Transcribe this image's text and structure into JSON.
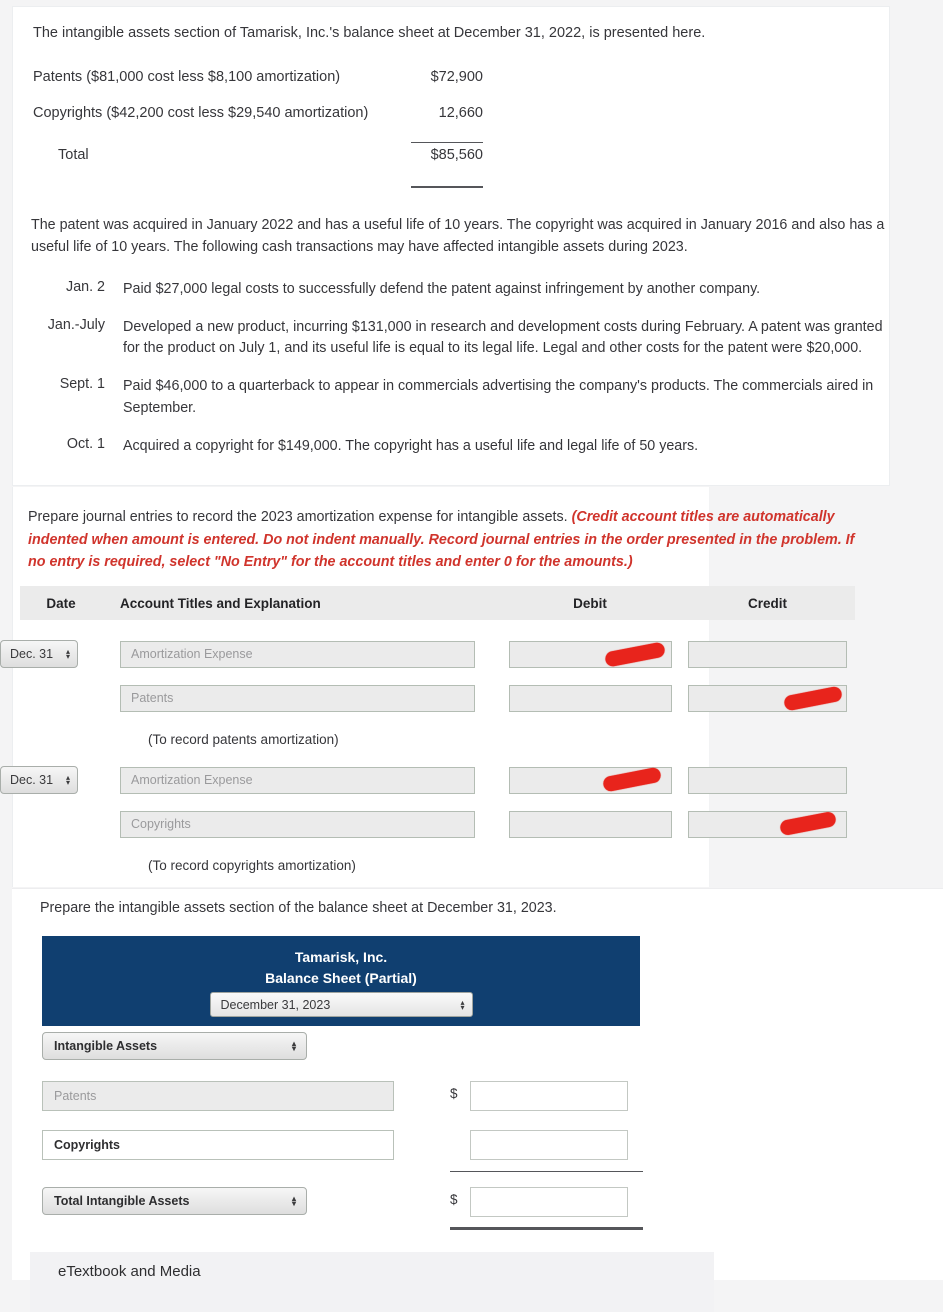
{
  "problem": {
    "intro": "The intangible assets section of Tamarisk, Inc.'s balance sheet at December 31, 2022, is presented here.",
    "summary": {
      "rows": [
        {
          "label": "Patents ($81,000 cost less $8,100 amortization)",
          "amount": "$72,900"
        },
        {
          "label": "Copyrights ($42,200 cost less $29,540 amortization)",
          "amount": "12,660"
        },
        {
          "label": "Total",
          "amount": "$85,560"
        }
      ]
    },
    "paragraph": "The patent was acquired in January 2022 and has a useful life of 10 years. The copyright was acquired in January 2016 and also has a useful life of 10 years. The following cash transactions may have affected intangible assets during 2023.",
    "transactions": [
      {
        "date": "Jan. 2",
        "text": "Paid $27,000 legal costs to successfully defend the patent against infringement by another company."
      },
      {
        "date": "Jan.-July",
        "text": "Developed a new product, incurring $131,000 in research and development costs during February. A patent was granted for the product on July 1, and its useful life is equal to its legal life. Legal and other costs for the patent were $20,000."
      },
      {
        "date": "Sept. 1",
        "text": "Paid $46,000 to a quarterback to appear in commercials advertising the company's products. The commercials aired in September."
      },
      {
        "date": "Oct. 1",
        "text": "Acquired a copyright for $149,000. The copyright has a useful life and legal life of 50 years."
      }
    ]
  },
  "journal": {
    "instruction_plain": "Prepare journal entries to record the 2023 amortization expense for intangible assets.",
    "instruction_italic": "(Credit account titles are automatically indented when amount is entered. Do not indent manually. Record journal entries in the order presented in the problem. If no entry is required, select \"No Entry\" for the account titles and enter 0 for the amounts.)",
    "headers": {
      "date": "Date",
      "account": "Account Titles and Explanation",
      "debit": "Debit",
      "credit": "Credit"
    },
    "entries": [
      {
        "date_value": "Dec. 31",
        "debit_line": {
          "account_placeholder": "Amortization Expense",
          "debit_value": "",
          "credit_value": ""
        },
        "credit_line": {
          "account_placeholder": "Patents",
          "debit_value": "",
          "credit_value": ""
        },
        "memo": "(To record patents amortization)"
      },
      {
        "date_value": "Dec. 31",
        "debit_line": {
          "account_placeholder": "Amortization Expense",
          "debit_value": "",
          "credit_value": ""
        },
        "credit_line": {
          "account_placeholder": "Copyrights",
          "debit_value": "",
          "credit_value": ""
        },
        "memo": "(To record copyrights amortization)"
      }
    ]
  },
  "balance_sheet": {
    "prompt": "Prepare the intangible assets section of the balance sheet at December 31, 2023.",
    "company": "Tamarisk, Inc.",
    "statement": "Balance Sheet (Partial)",
    "date_selected": "December 31, 2023",
    "section_header": "Intangible Assets",
    "rows": [
      {
        "label_placeholder": "Patents",
        "label_value": "",
        "amount": "",
        "dollar": "$",
        "filled": false
      },
      {
        "label_placeholder": "",
        "label_value": "Copyrights",
        "amount": "",
        "dollar": "",
        "filled": true
      }
    ],
    "total_label": "Total Intangible Assets",
    "total_dollar": "$",
    "total_amount": ""
  },
  "footer": {
    "etextbook_label": "eTextbook and Media"
  },
  "colors": {
    "navy": "#103f70",
    "marker_red": "#e8241c",
    "instruction_red": "#d0342c",
    "input_grey": "#ebebeb"
  },
  "icons": {
    "spinner_up": "▴",
    "spinner_down": "▾"
  }
}
